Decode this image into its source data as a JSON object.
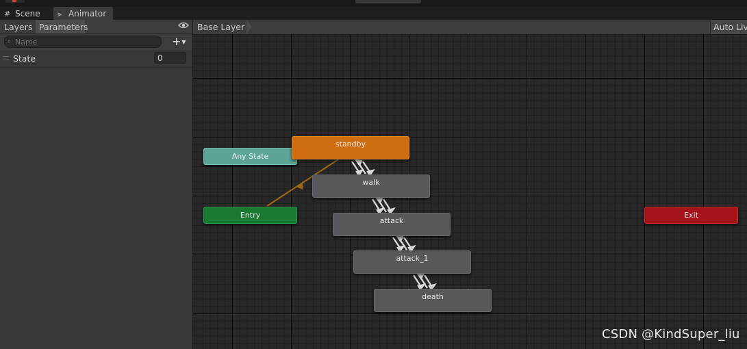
{
  "window_tabs": [
    {
      "label": "Scene",
      "icon": "grid-icon"
    },
    {
      "label": "Animator",
      "icon": "animator-icon"
    }
  ],
  "left_panel": {
    "tabs": [
      "Layers",
      "Parameters"
    ],
    "active_tab": "Parameters",
    "search_placeholder": "Name",
    "add_button": "+",
    "parameters": [
      {
        "name": "State",
        "value": "0"
      }
    ]
  },
  "graph": {
    "breadcrumb": "Base Layer",
    "auto_live_label": "Auto Live",
    "nodes": {
      "any_state": "Any State",
      "entry": "Entry",
      "exit": "Exit",
      "standby": "standby",
      "walk": "walk",
      "attack": "attack",
      "attack_1": "attack_1",
      "death": "death"
    },
    "colors": {
      "default_state": "#cf6d12",
      "any_state": "#5da397",
      "entry": "#1b7a31",
      "exit": "#a5141a",
      "state": "#56585c",
      "entry_transition": "#a06a10"
    }
  },
  "watermark": "CSDN @KindSuper_liu"
}
